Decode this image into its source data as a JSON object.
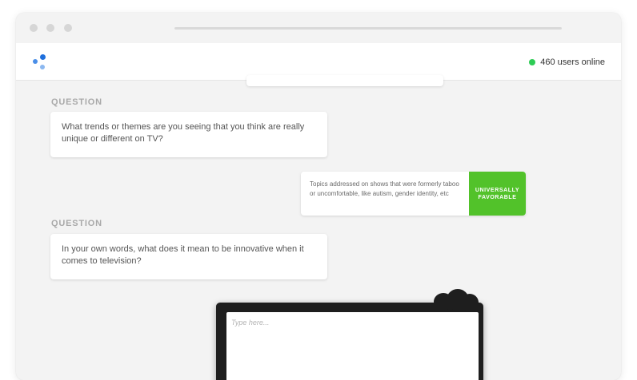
{
  "header": {
    "online_count_text": "460 users online",
    "online_color": "#2ecc55"
  },
  "conversation": {
    "questions": [
      {
        "label": "QUESTION",
        "text": "What trends or themes are you seeing that you think are really unique or different on TV?"
      },
      {
        "label": "QUESTION",
        "text": "In your own words, what does it mean to be innovative when it comes to television?"
      }
    ],
    "answer": {
      "text": "Topics addressed on shows that were formerly taboo or uncomfortable, like autism, gender identity, etc",
      "badge": "UNIVERSALLY FAVORABLE",
      "badge_color": "#52c22a"
    }
  },
  "response_box": {
    "placeholder": "Type here..."
  },
  "icons": {
    "logo": "three-dot-logo-icon",
    "status": "online-dot-icon"
  }
}
